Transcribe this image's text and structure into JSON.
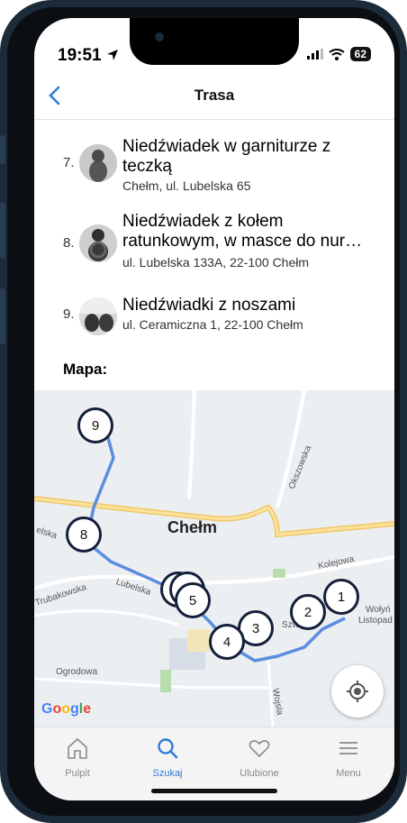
{
  "status": {
    "time": "19:51",
    "battery": "62"
  },
  "nav": {
    "title": "Trasa"
  },
  "items": [
    {
      "num": "7.",
      "name": "Niedźwiadek w garniturze z teczką",
      "address": "Chełm, ul. Lubelska 65"
    },
    {
      "num": "8.",
      "name": "Niedźwiadek z kołem ratunkowym, w masce do nur…",
      "address": "ul. Lubelska 133A, 22-100 Chełm"
    },
    {
      "num": "9.",
      "name": "Niedźwiadki z noszami",
      "address": "ul. Ceramiczna 1, 22-100 Chełm"
    }
  ],
  "map": {
    "title": "Mapa:",
    "city": "Chełm",
    "labels": {
      "okszowska": "Okszowska",
      "kolejowa": "Kolejowa",
      "lubelska": "Lubelska",
      "trubakowska": "Trubakowska",
      "ogrodowa": "Ogrodowa",
      "wolyn": "Wołyń",
      "listopad": "Listopad",
      "szw": "Szw",
      "wojsla": "Wojsla",
      "elska": "elska"
    },
    "google": "Google",
    "markers": [
      "9",
      "8",
      "5",
      "4",
      "3",
      "2",
      "1"
    ]
  },
  "tabs": [
    {
      "label": "Pulpit",
      "icon": "home-icon"
    },
    {
      "label": "Szukaj",
      "icon": "search-icon"
    },
    {
      "label": "Ulubione",
      "icon": "heart-icon"
    },
    {
      "label": "Menu",
      "icon": "menu-icon"
    }
  ],
  "colors": {
    "accent": "#2f7ad6",
    "marker_border": "#14203a",
    "route": "#5b8de0"
  }
}
